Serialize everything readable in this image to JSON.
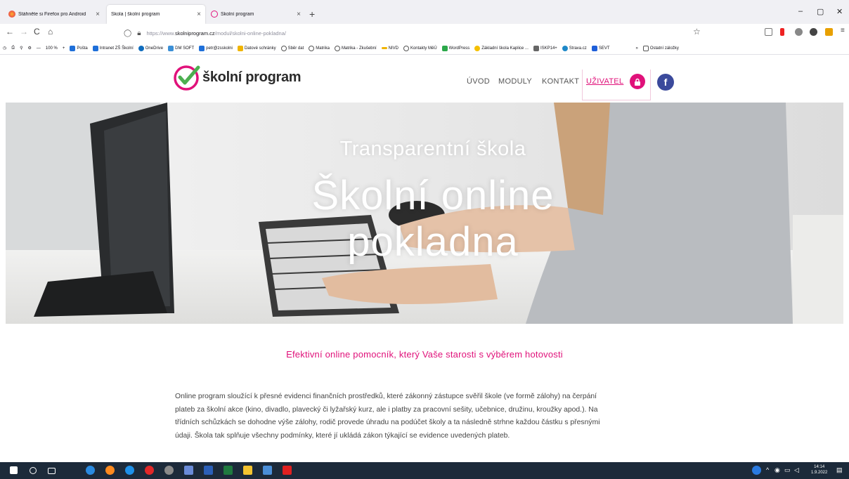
{
  "browser": {
    "tabs": [
      {
        "label": "Stáhněte si Firefox pro Android",
        "close": "×"
      },
      {
        "label": "Škola | školní program",
        "close": "×"
      },
      {
        "label": "Školní program",
        "close": "×"
      }
    ],
    "new_tab": "+",
    "window_controls": {
      "minimize": "–",
      "maximize": "▢",
      "close": "✕"
    },
    "nav": {
      "back": "←",
      "forward": "→",
      "reload": "C",
      "home": "⌂"
    },
    "url_prefix": "https://www.",
    "url_host": "skolniprogram.cz",
    "url_path": "/modul/skolni-online-pokladna/",
    "bookmark_star": "☆",
    "colors": {
      "accent": "#e0117a",
      "tabstrip": "#f0f0f4"
    }
  },
  "bookmarks": {
    "zoom": "100 %",
    "zoom_plus": "+",
    "zoom_minus": "—",
    "items": [
      {
        "label": "Pošta",
        "color": "#1e6fd9"
      },
      {
        "label": "Intranet ZŠ Školní",
        "color": "#1e6fd9"
      },
      {
        "label": "OneDrive",
        "color": "#0f6cbd"
      },
      {
        "label": "DM SOFT",
        "color": "#3b8fd6"
      },
      {
        "label": "petr@zsskolni",
        "color": "#1e6fd9"
      },
      {
        "label": "Datové schránky",
        "color": "#f0b400"
      },
      {
        "label": "Sběr dat",
        "color": "#555555"
      },
      {
        "label": "Matrika",
        "color": "#555555"
      },
      {
        "label": "Matrika - Zkušební",
        "color": "#555555"
      },
      {
        "label": "NIVD",
        "color": "#f0b400"
      },
      {
        "label": "Kontakty MěÚ",
        "color": "#555555"
      },
      {
        "label": "WordPress",
        "color": "#2ba84a"
      },
      {
        "label": "Základní škola Kaplice ...",
        "color": "#f5c000"
      },
      {
        "label": "ISKP14+",
        "color": "#666666"
      },
      {
        "label": "Strava.cz",
        "color": "#1e88c8"
      },
      {
        "label": "SEVT",
        "color": "#1e5fd9"
      }
    ],
    "more": "»",
    "other": "Ostatní záložky"
  },
  "site": {
    "logo_text": "školní program",
    "menu": [
      "ÚVOD",
      "MODULY",
      "KONTAKT",
      "UŽIVATEL"
    ],
    "facebook_letter": "f",
    "colors": {
      "accent": "#e0117a",
      "facebook": "#3b4a9c"
    }
  },
  "hero": {
    "subtitle": "Transparentní škola",
    "title_line1": "Školní online",
    "title_line2": "pokladna"
  },
  "content": {
    "tagline": "Efektivní online pomocník, který Vaše starosti s výběrem hotovosti",
    "paragraph": [
      "Online program sloužící k přesné evidenci finančních prostředků, které zákonný zástupce svěřil škole (ve formě zálohy) na čerpání",
      "plateb za školní akce (kino, divadlo, plavecký či lyžařský kurz, ale i platby za pracovní sešity, učebnice, družinu, kroužky apod.). Na",
      "třídních schůzkách se dohodne výše zálohy, rodič provede úhradu na podúčet školy a ta následně strhne každou částku s přesnými",
      "údaji. Škola tak splňuje všechny podmínky, které jí ukládá zákon týkající se evidence uvedených plateb."
    ]
  },
  "taskbar": {
    "time": "14:14",
    "date": "1.9.2022"
  }
}
